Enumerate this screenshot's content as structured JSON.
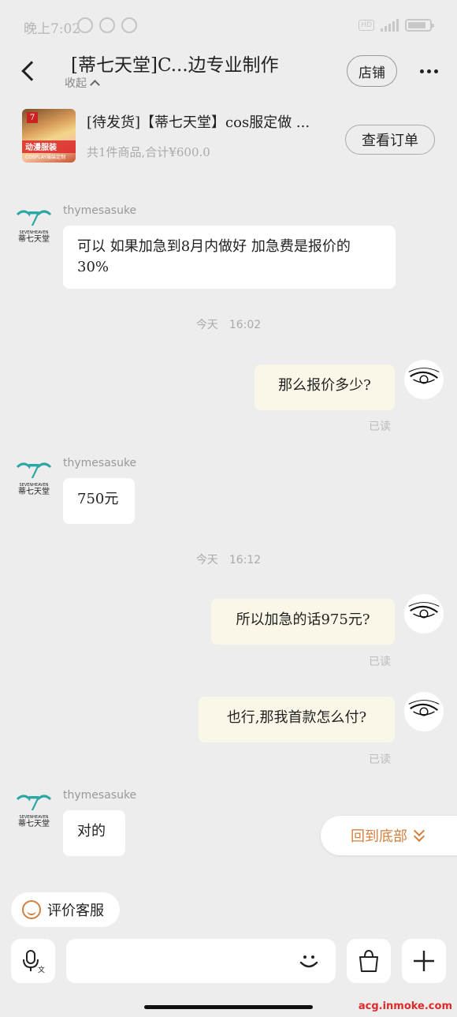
{
  "status_bar": {
    "time": "晚上7:02"
  },
  "header": {
    "title": "[蒂七天堂]C...边专业制作",
    "collapse_label": "收起",
    "store_button": "店铺"
  },
  "order": {
    "title": "[待发货]【蒂七天堂】cos服定做 ...",
    "summary": "共1件商品,合计¥600.0",
    "view_button": "查看订单",
    "thumb_text": "动漫服装",
    "thumb_sub": "COSPLAY服装定制"
  },
  "shop": {
    "name": "thymesasuke",
    "logo_text": "SEVENHEAVEN",
    "logo_cn": "蒂七天堂"
  },
  "messages": {
    "m1": "可以 如果加急到8月内做好 加急费是报价的30%",
    "sep1_day": "今天",
    "sep1_time": "16:02",
    "m2": "那么报价多少?",
    "read1": "已读",
    "m3": "750元",
    "sep2_day": "今天",
    "sep2_time": "16:12",
    "m4": "所以加急的话975元?",
    "read2": "已读",
    "m5": "也行,那我首款怎么付?",
    "read3": "已读",
    "m6": "对的"
  },
  "floating": {
    "to_bottom": "回到底部",
    "rate_service": "评价客服"
  },
  "input": {
    "placeholder": ""
  },
  "watermark": "acg.inmoke.com"
}
